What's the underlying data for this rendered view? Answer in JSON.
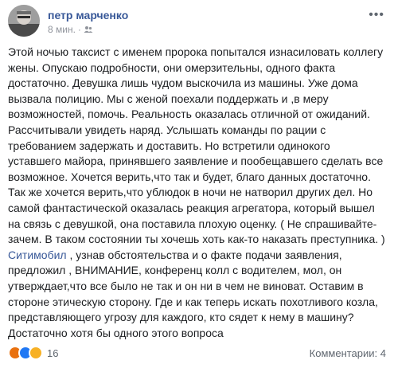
{
  "post": {
    "author": "петр марченко",
    "time": "8 мин.",
    "privacy_icon": "friends-icon",
    "more_icon": "more-options-icon",
    "text_before_link": "Этой ночью таксист с именем пророка попытался изнасиловать коллегу жены. Опускаю подробности, они омерзительны, одного факта достаточно. Девушка лишь чудом выскочила из машины. Уже дома вызвала полицию. Мы с женой поехали поддержать и ,в меру возможностей, помочь. Реальность оказалась отличной от ожиданий. Рассчитывали увидеть наряд. Услышать команды по рации с требованием задержать и доставить. Но встретили одинокого уставшего майора, принявшего заявление и пообещавшего сделать все возможное. Хочется верить,что так и будет, благо данных достаточно. Так же хочется верить,что ублюдок в ночи не натворил других дел. Но самой фантастической оказалась реакция агрегатора, который вышел на связь с девушкой, она поставила плохую оценку. ( Не спрашивайте- зачем. В таком состоянии ты хочешь хоть как-то наказать преступника. )",
    "link_text": "Ситимобил",
    "text_after_link": " , узнав обстоятельства и о факте подачи заявления, предложил , ВНИМАНИЕ, конференц колл с водителем, мол, он утверждает,что все было не так и он ни в чем не виноват. Оставим в стороне этическую сторону. Где и как теперь искать похотливого козла, представляющего угрозу для каждого, кто сядет к нему в машину? Достаточно хотя бы одного этого вопроса"
  },
  "footer": {
    "reaction_icons": [
      "angry-reaction-icon",
      "like-reaction-icon",
      "wow-reaction-icon"
    ],
    "reaction_count": "16",
    "comments": "Комментарии: 4"
  }
}
